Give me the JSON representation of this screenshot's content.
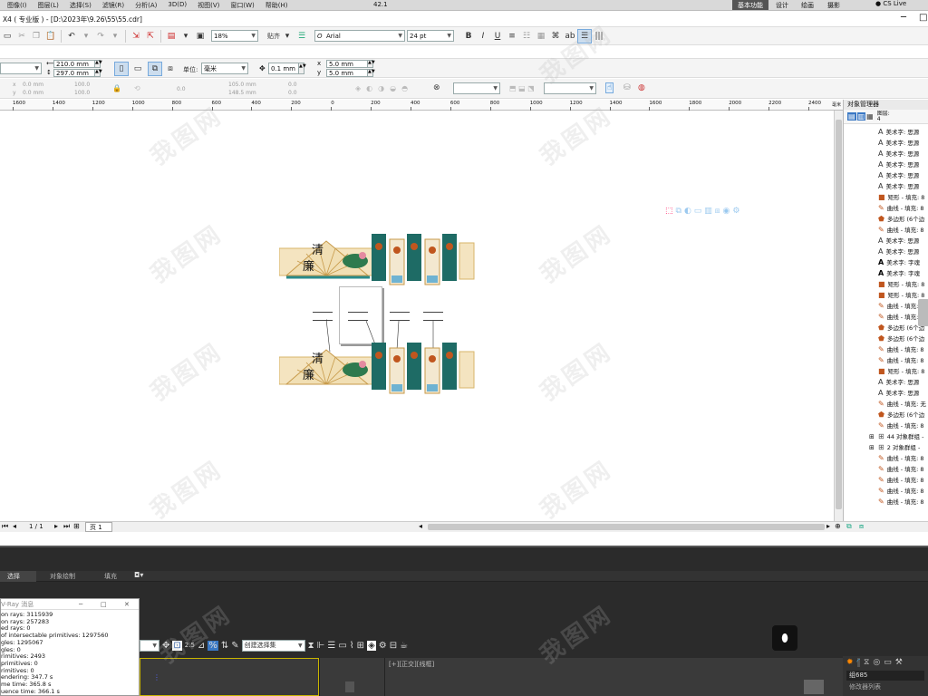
{
  "menubar": {
    "items": [
      "图像(I)",
      "图层(L)",
      "选择(S)",
      "滤镜(R)",
      "分析(A)",
      "3D(D)",
      "视图(V)",
      "窗口(W)",
      "帮助(H)"
    ],
    "zoom": "42.1",
    "workspace": "基本功能",
    "tabs": [
      "设计",
      "绘画",
      "摄影"
    ],
    "cs_live": "CS Live"
  },
  "titlebar": {
    "app": "X4",
    "edition": "( 专业版 )",
    "separator": " - ",
    "path": "[D:\\2023年\\9.26\\55\\55.cdr]"
  },
  "toolbar1": {
    "zoom": "18%",
    "snap": "贴齐",
    "font_glyph": "O",
    "font": "Arial",
    "font_size": "24 pt"
  },
  "propbar": {
    "width": "210.0 mm",
    "height": "297.0 mm",
    "unit_label": "单位:",
    "unit": "毫米",
    "nudge": "0.1 mm",
    "dup_x": "5.0 mm",
    "dup_y": "5.0 mm"
  },
  "transform": {
    "x": "0.0 mm",
    "y": "0.0 mm",
    "sx": "100.0",
    "sy": "100.0",
    "rot": "0.0",
    "px": "105.0 mm",
    "py": "148.5 mm",
    "a1": "0.0",
    "a2": "0.0"
  },
  "ruler": {
    "ticks": [
      "1600",
      "1400",
      "1200",
      "1000",
      "800",
      "600",
      "400",
      "200",
      "0",
      "200",
      "400",
      "600",
      "800",
      "1000",
      "1200",
      "1400",
      "1600",
      "1800",
      "2000",
      "2200",
      "2400"
    ],
    "unit": "毫米"
  },
  "object_manager": {
    "title": "对象管理器",
    "layer_label": "图层:",
    "layer_num": "4",
    "items": [
      {
        "icon": "A",
        "text": "美术字:  思源"
      },
      {
        "icon": "A",
        "text": "美术字:  思源"
      },
      {
        "icon": "A",
        "text": "美术字:  思源"
      },
      {
        "icon": "A",
        "text": "美术字:  思源"
      },
      {
        "icon": "A",
        "text": "美术字:  思源"
      },
      {
        "icon": "A",
        "text": "美术字:  思源"
      },
      {
        "icon": "rect",
        "text": "矩形 - 填充: 8"
      },
      {
        "icon": "curve",
        "text": "曲线 - 填充: 8"
      },
      {
        "icon": "poly",
        "text": "多边形 (6个边"
      },
      {
        "icon": "curve",
        "text": "曲线 - 填充: 8"
      },
      {
        "icon": "A",
        "text": "美术字:  思源"
      },
      {
        "icon": "A",
        "text": "美术字:  思源"
      },
      {
        "icon": "Abold",
        "text": "美术字:  字魂"
      },
      {
        "icon": "Abold",
        "text": "美术字:  字魂"
      },
      {
        "icon": "rect",
        "text": "矩形 - 填充: 8"
      },
      {
        "icon": "rect",
        "text": "矩形 - 填充: 8"
      },
      {
        "icon": "curve",
        "text": "曲线 - 填充: 8"
      },
      {
        "icon": "curve",
        "text": "曲线 - 填充: 8"
      },
      {
        "icon": "poly",
        "text": "多边形 (6个边"
      },
      {
        "icon": "poly",
        "text": "多边形 (6个边"
      },
      {
        "icon": "curve",
        "text": "曲线 - 填充: 8"
      },
      {
        "icon": "curve",
        "text": "曲线 - 填充: 8"
      },
      {
        "icon": "rect",
        "text": "矩形 - 填充: 8"
      },
      {
        "icon": "A",
        "text": "美术字:  思源"
      },
      {
        "icon": "A",
        "text": "美术字:  思源"
      },
      {
        "icon": "curve",
        "text": "曲线 - 填充: 无"
      },
      {
        "icon": "poly",
        "text": "多边形 (6个边"
      },
      {
        "icon": "curve",
        "text": "曲线 - 填充: 8"
      },
      {
        "icon": "group",
        "text": "44 对象群组 - "
      },
      {
        "icon": "group",
        "text": "2 对象群组 - "
      },
      {
        "icon": "curve",
        "text": "曲线 - 填充: 8"
      },
      {
        "icon": "curve",
        "text": "曲线 - 填充: 8"
      },
      {
        "icon": "curve",
        "text": "曲线 - 填充: 8"
      },
      {
        "icon": "curve",
        "text": "曲线 - 填充: 8"
      },
      {
        "icon": "curve",
        "text": "曲线 - 填充: 8"
      }
    ]
  },
  "artwork": {
    "char1": "清",
    "char2": "廉"
  },
  "statusbar": {
    "page_count": "1 / 1",
    "page_tab": "页 1"
  },
  "max": {
    "tabs": [
      "选择",
      "对象绘制",
      "填充"
    ],
    "dialog_title": "V-Ray 消息",
    "messages": [
      "on rays: 3115939",
      "on rays: 257283",
      "ed rays: 0",
      "of intersectable primitives: 1297560",
      "gles: 1295067",
      "gles: 0",
      "rimitives: 2493",
      "primitives: 0",
      "rimitives: 0",
      "endering: 347.7 s",
      "me time: 365.8 s",
      "uence time: 366.1 s"
    ],
    "selection_set": "创建选择集",
    "spin_label": "2.5",
    "viewport_label": "[+][正交][线框]",
    "group_label": "组685",
    "modifier_list": "修改器列表"
  },
  "watermark": "我图网",
  "colors": {
    "teal": "#1e6b65",
    "brand_orange": "#c0561e",
    "gold": "#d7b46a",
    "max_bg": "#2b2b2b",
    "max_dark": "#1b1b1b"
  }
}
